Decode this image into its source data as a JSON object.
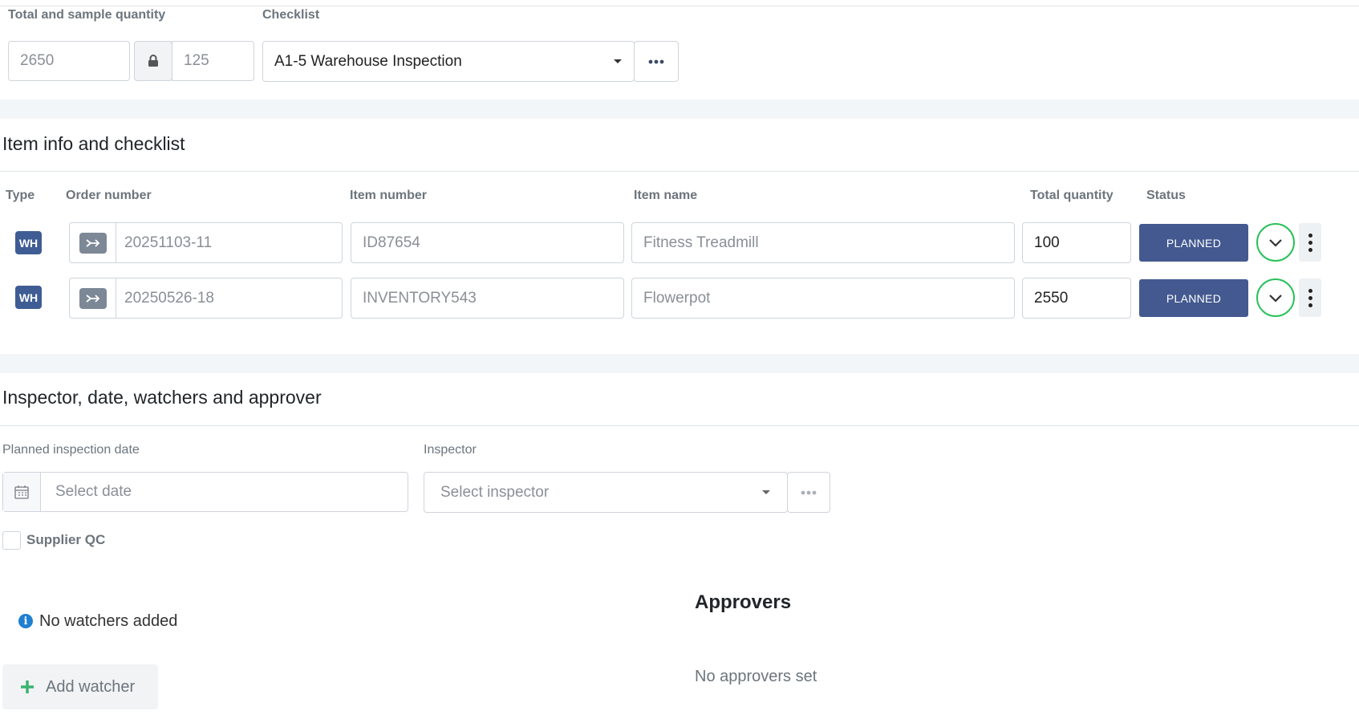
{
  "top": {
    "quantity_label": "Total and sample quantity",
    "total_quantity": "2650",
    "sample_quantity": "125",
    "checklist_label": "Checklist",
    "checklist_value": "A1-5 Warehouse Inspection"
  },
  "items_section": {
    "title": "Item info and checklist",
    "headers": {
      "type": "Type",
      "order_number": "Order number",
      "item_number": "Item number",
      "item_name": "Item name",
      "total_quantity": "Total quantity",
      "status": "Status"
    },
    "rows": [
      {
        "type": "WH",
        "order_number": "20251103-11",
        "item_number": "ID87654",
        "item_name": "Fitness Treadmill",
        "total_quantity": "100",
        "status": "PLANNED"
      },
      {
        "type": "WH",
        "order_number": "20250526-18",
        "item_number": "INVENTORY543",
        "item_name": "Flowerpot",
        "total_quantity": "2550",
        "status": "PLANNED"
      }
    ]
  },
  "inspector_section": {
    "title": "Inspector, date, watchers and approver",
    "date_label": "Planned inspection date",
    "date_placeholder": "Select date",
    "inspector_label": "Inspector",
    "inspector_placeholder": "Select inspector",
    "supplier_qc_label": "Supplier QC",
    "watchers_empty": "No watchers added",
    "add_watcher_label": "Add watcher",
    "approvers_title": "Approvers",
    "approvers_empty": "No approvers set"
  },
  "colors": {
    "primary": "#43598f",
    "success_ring": "#28c15a",
    "info_icon": "#1f7fd1",
    "add_icon": "#3cb371"
  }
}
